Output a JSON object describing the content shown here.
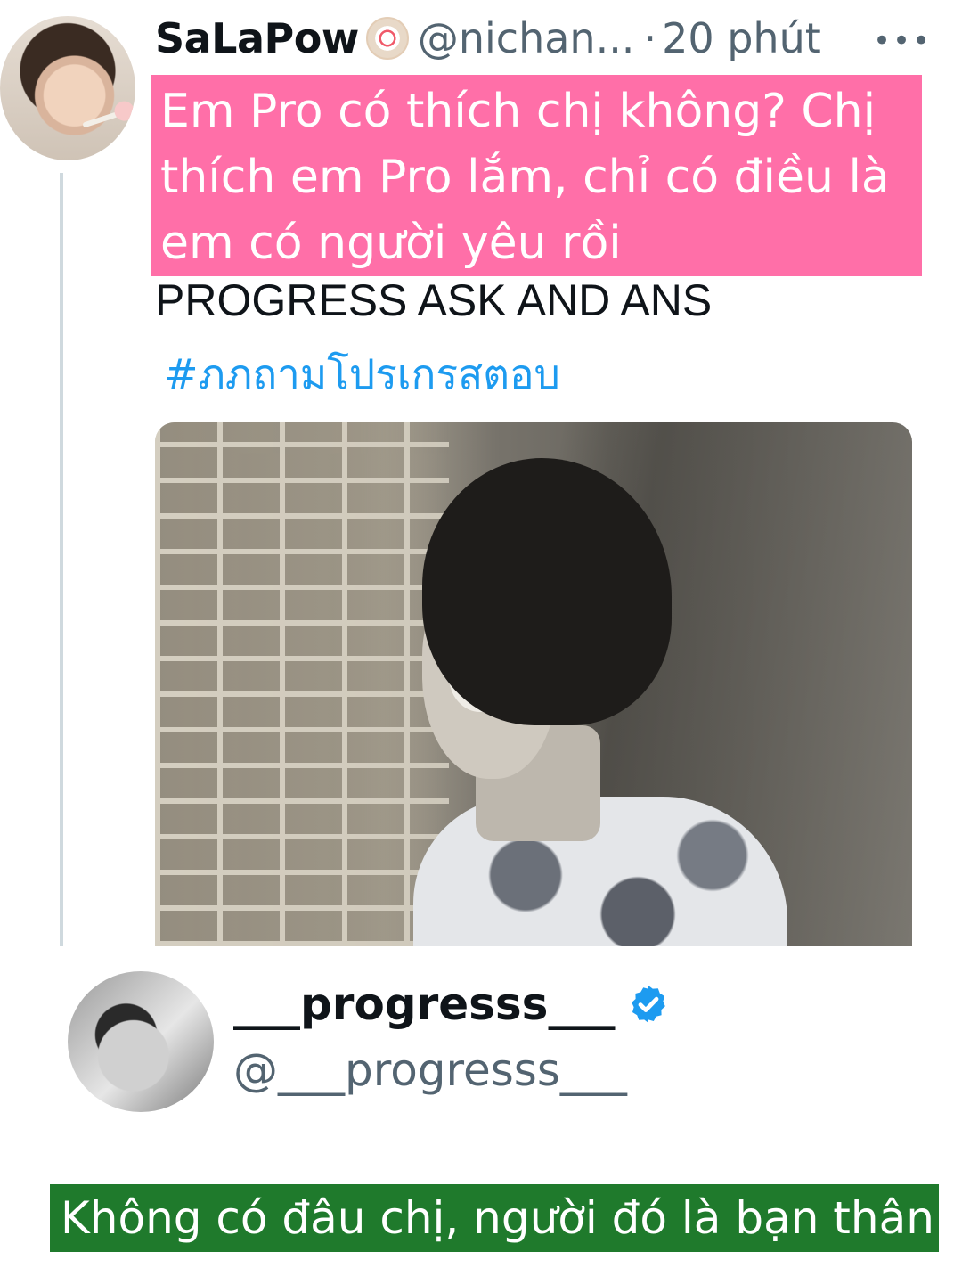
{
  "tweet": {
    "author_name": "SaLaPow",
    "author_handle": "@nichan...",
    "separator": "·",
    "time": "20 phút",
    "more_icon": "ellipsis-icon",
    "question_overlay": "Em Pro có thích chị không? Chị\nthích em Pro lắm, chỉ có điều là\nem có người yêu rồi",
    "title": "PROGRESS ASK AND ANS",
    "hashtag": "#ภภถามโปรเกรสตอบ"
  },
  "reply": {
    "author_name": "___progresss___",
    "author_handle": "@___progresss___",
    "verified_icon": "verified-badge-icon",
    "answer_overlay": "Không có đâu chị, người đó là bạn thân"
  },
  "colors": {
    "question_bg": "#ff6fa8",
    "answer_bg": "#1f7a2c",
    "hashtag": "#1d9bf0",
    "secondary_text": "#536471",
    "verified": "#1d9bf0"
  }
}
